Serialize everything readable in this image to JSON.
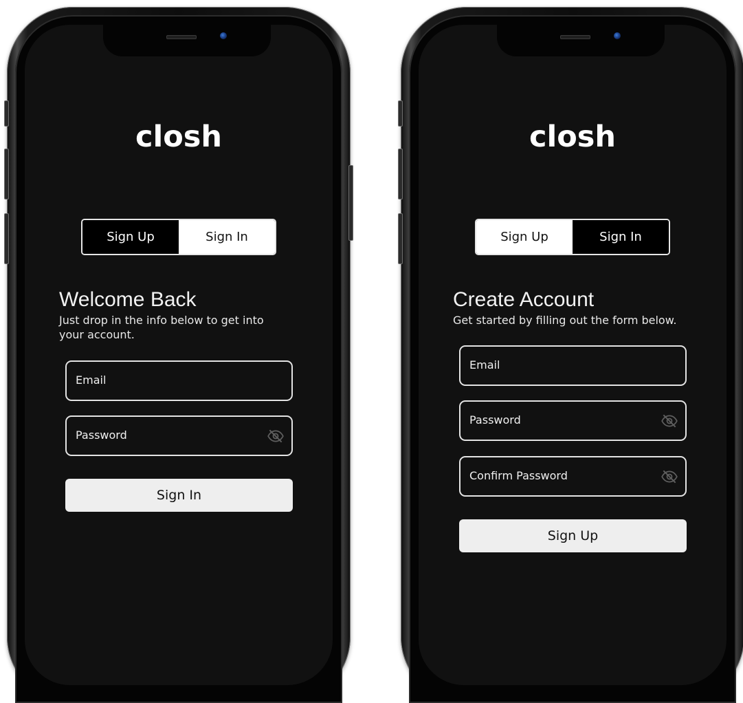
{
  "screens": [
    {
      "brand": "closh",
      "toggle": {
        "sign_up": "Sign Up",
        "sign_in": "Sign In",
        "active": "sign_up"
      },
      "title": "Welcome Back",
      "subtitle": "Just drop in the info below to get into your account.",
      "fields": [
        {
          "label": "Email",
          "has_eye": false
        },
        {
          "label": "Password",
          "has_eye": true
        }
      ],
      "button": "Sign In"
    },
    {
      "brand": "closh",
      "toggle": {
        "sign_up": "Sign Up",
        "sign_in": "Sign In",
        "active": "sign_in"
      },
      "title": "Create Account",
      "subtitle": "Get started by filling out the form below.",
      "fields": [
        {
          "label": "Email",
          "has_eye": false
        },
        {
          "label": "Password",
          "has_eye": true
        },
        {
          "label": "Confirm Password",
          "has_eye": true
        }
      ],
      "button": "Sign Up"
    }
  ],
  "colors": {
    "screen_bg": "#111111",
    "toggle_active_bg": "#000000",
    "toggle_inactive_bg": "#ffffff",
    "button_bg": "#eeeeee",
    "field_border": "#e4e4e4"
  },
  "icons": {
    "eye": "eye-off-icon",
    "camera": "front-camera-icon"
  }
}
